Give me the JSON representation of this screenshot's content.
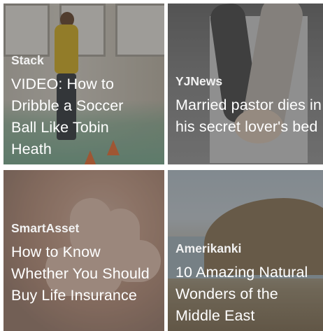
{
  "tiles": [
    {
      "source": "Stack",
      "title": "VIDEO: How to Dribble a Soccer Ball Like Tobin Heath"
    },
    {
      "source": "YJNews",
      "title": "Married pastor dies in his secret lover's bed"
    },
    {
      "source": "SmartAsset",
      "title": "How to Know Whether You Should Buy Life Insurance"
    },
    {
      "source": "Amerikanki",
      "title": "10 Amazing Natural Wonders of the Middle East"
    }
  ]
}
